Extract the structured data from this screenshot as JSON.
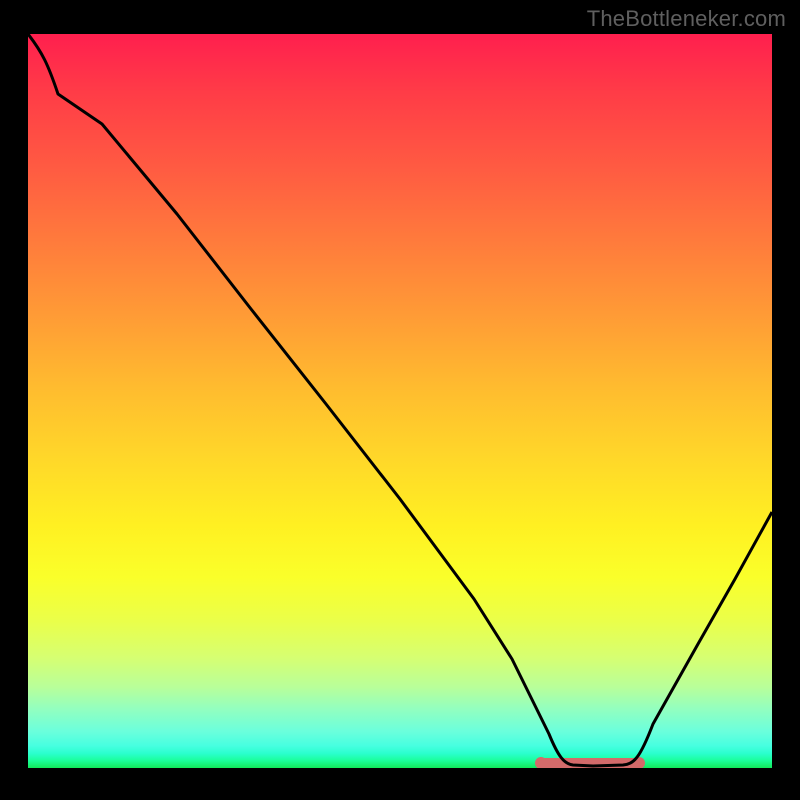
{
  "watermark": "TheBottleneker.com",
  "chart_data": {
    "type": "line",
    "title": "",
    "xlabel": "",
    "ylabel": "",
    "xlim": [
      0,
      100
    ],
    "ylim": [
      0,
      100
    ],
    "description": "Bottleneck percentage curve on a red-to-green vertical gradient. The black curve starts near 100% at x≈0, falls roughly linearly to 0% around x≈70, stays near 0% until x≈82, then rises toward ~35% at x=100. A short salmon-pink horizontal band marks the flat minimum segment.",
    "series": [
      {
        "name": "bottleneck-curve",
        "x": [
          0,
          3,
          10,
          20,
          30,
          40,
          50,
          60,
          65,
          70,
          72,
          76,
          80,
          82,
          85,
          90,
          95,
          100
        ],
        "values": [
          100,
          97,
          88,
          76,
          63,
          50,
          37,
          23,
          15,
          5,
          0.5,
          0.2,
          0.4,
          1,
          7,
          17,
          26,
          35
        ]
      }
    ],
    "marker": {
      "name": "min-plateau",
      "x_start": 69,
      "x_end": 82,
      "y": 0.6,
      "color": "#d46a6a"
    },
    "gradient_stops": [
      {
        "pct": 0,
        "color": "#ff1f4e"
      },
      {
        "pct": 50,
        "color": "#ffd829"
      },
      {
        "pct": 75,
        "color": "#faff2a"
      },
      {
        "pct": 100,
        "color": "#12e85a"
      }
    ]
  }
}
